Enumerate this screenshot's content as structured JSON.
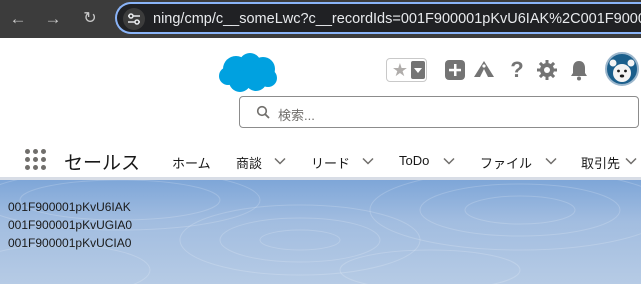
{
  "browser": {
    "url": "ning/cmp/c__someLwc?c__recordIds=001F900001pKvU6IAK%2C001F90000",
    "icons": [
      "back-arrow-icon",
      "forward-arrow-icon",
      "reload-icon",
      "site-settings-icon"
    ]
  },
  "header": {
    "search_placeholder": "検索...",
    "help_glyph": "?",
    "icons": [
      "salesforce-cloud-logo",
      "favorite-star-icon",
      "global-add-icon",
      "trailhead-icon",
      "help-icon",
      "setup-gear-icon",
      "notifications-bell-icon",
      "user-avatar"
    ]
  },
  "app_nav": {
    "app_name": "セールス",
    "items": [
      {
        "label": "ホーム",
        "has_menu": false
      },
      {
        "label": "商談",
        "has_menu": true
      },
      {
        "label": "リード",
        "has_menu": true
      },
      {
        "label": "ToDo",
        "has_menu": true
      },
      {
        "label": "ファイル",
        "has_menu": true
      },
      {
        "label": "取引先",
        "has_menu": true
      }
    ]
  },
  "content": {
    "record_ids": [
      "001F900001pKvU6IAK",
      "001F900001pKvUGIA0",
      "001F900001pKvUCIA0"
    ]
  },
  "colors": {
    "chrome_bg": "#3c3c3c",
    "url_focus": "#8ab4f8",
    "salesforce_blue": "#00a1e0",
    "content_bg": "#a2bde0"
  }
}
